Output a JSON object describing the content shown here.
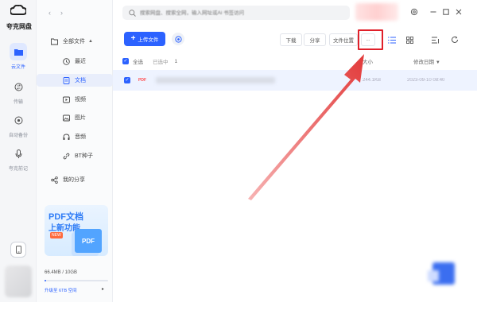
{
  "app": {
    "logo_text": "夸克网盘"
  },
  "rail": {
    "items": [
      {
        "label": "云文件",
        "icon": "cloud-folder-icon",
        "active": true
      },
      {
        "label": "传输",
        "icon": "transfer-icon",
        "active": false
      },
      {
        "label": "自动备份",
        "icon": "backup-icon",
        "active": false
      },
      {
        "label": "夸克前记",
        "icon": "record-icon",
        "active": false
      }
    ]
  },
  "sidebar": {
    "all_files": "全部文件",
    "items": [
      {
        "label": "最近",
        "icon": "clock-icon"
      },
      {
        "label": "文档",
        "icon": "document-icon"
      },
      {
        "label": "视频",
        "icon": "video-icon"
      },
      {
        "label": "图片",
        "icon": "image-icon"
      },
      {
        "label": "音频",
        "icon": "headphones-icon"
      },
      {
        "label": "BT种子",
        "icon": "link-icon"
      }
    ],
    "my_share": "我的分享",
    "promo": {
      "line1": "PDF文档",
      "line2": "上新功能",
      "badge": "NEW",
      "doc_label": "PDF"
    },
    "storage": {
      "text": "66.4MB / 10GB",
      "used_fraction": 0.02,
      "upgrade": "升级至 6TB 空间"
    }
  },
  "header": {
    "search_placeholder": "搜索网盘、搜索全网，输入网址或Ai 书签访问"
  },
  "toolbar": {
    "upload_label": "上传文件",
    "download_label": "下载",
    "share_label": "分享",
    "location_label": "文件位置",
    "more_label": "..."
  },
  "table": {
    "select_all": "全选",
    "selected_text": "已选中",
    "selected_count": "1",
    "col_size": "大小",
    "col_date": "修改日期",
    "rows": [
      {
        "type": "PDF",
        "size": "244.1KB",
        "date": "2023-09-10 08:40"
      }
    ]
  },
  "colors": {
    "accent": "#2c62ff",
    "highlight": "#e0202a",
    "arrow": "#e23a3a"
  }
}
